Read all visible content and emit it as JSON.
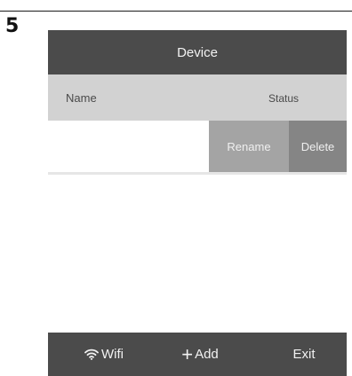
{
  "step": {
    "number": "5"
  },
  "titlebar": {
    "title": "Device"
  },
  "table": {
    "columns": {
      "name": "Name",
      "status": "Status"
    },
    "rows": [
      {
        "name": "",
        "actions": {
          "rename": "Rename",
          "delete": "Delete"
        }
      }
    ]
  },
  "bottom_bar": {
    "items": [
      {
        "label": "Wifi",
        "icon": "wifi-icon"
      },
      {
        "label": "Add",
        "icon": "plus-icon"
      },
      {
        "label": "Exit",
        "icon": ""
      }
    ]
  },
  "colors": {
    "bar": "#4b4b4b",
    "header": "#d2d2d2",
    "rename": "#a4a4a4",
    "delete": "#858585"
  }
}
